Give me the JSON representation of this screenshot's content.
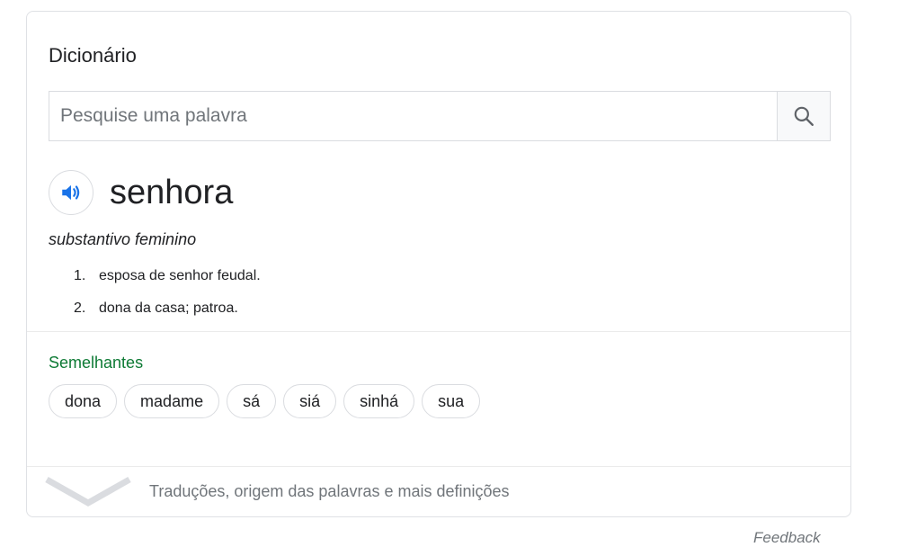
{
  "dictionary": {
    "title": "Dicionário",
    "search": {
      "placeholder": "Pesquise uma palavra",
      "value": ""
    },
    "entry": {
      "word": "senhora",
      "part_of_speech": "substantivo feminino",
      "definitions": [
        {
          "number": "1.",
          "text": "esposa de senhor feudal."
        },
        {
          "number": "2.",
          "text": "dona da casa; patroa."
        }
      ]
    },
    "similar": {
      "label": "Semelhantes",
      "words": [
        "dona",
        "madame",
        "sá",
        "siá",
        "sinhá",
        "sua"
      ]
    },
    "more_link": "Traduções, origem das palavras e mais definições"
  },
  "feedback_label": "Feedback",
  "colors": {
    "accent_blue": "#1a73e8",
    "similar_green": "#0d7a34",
    "border": "#dadce0",
    "muted_text": "#70757a"
  },
  "icons": {
    "search": "search-icon",
    "speaker": "speaker-icon",
    "expand": "chevron-down-icon"
  }
}
